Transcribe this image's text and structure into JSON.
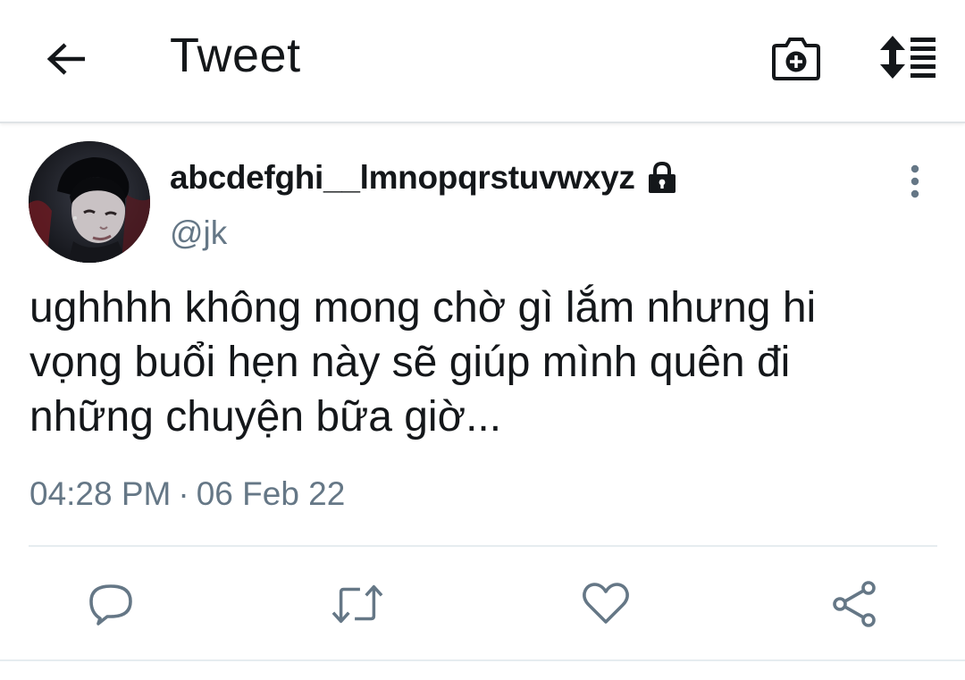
{
  "header": {
    "title": "Tweet",
    "back_icon": "arrow-left-icon",
    "camera_icon": "camera-plus-icon",
    "sort_icon": "sort-list-icon"
  },
  "tweet": {
    "display_name": "abcdefghi__lmnopqrstuvwxyz",
    "protected_icon": "lock-icon",
    "handle": "@jk",
    "text": "ughhhh không mong chờ gì lắm nhưng hi\nvọng buổi hẹn này sẽ giúp mình quên đi\nnhững chuyện bữa giờ...",
    "time": "04:28 PM",
    "separator": "·",
    "date": "06 Feb 22",
    "more_icon": "more-vertical-icon"
  },
  "actions": {
    "reply_icon": "reply-icon",
    "retweet_icon": "retweet-icon",
    "like_icon": "heart-icon",
    "share_icon": "share-icon"
  },
  "colors": {
    "text_primary": "#14171a",
    "text_secondary": "#657786",
    "icon_action": "#657786",
    "divider": "#e6ecf0"
  }
}
